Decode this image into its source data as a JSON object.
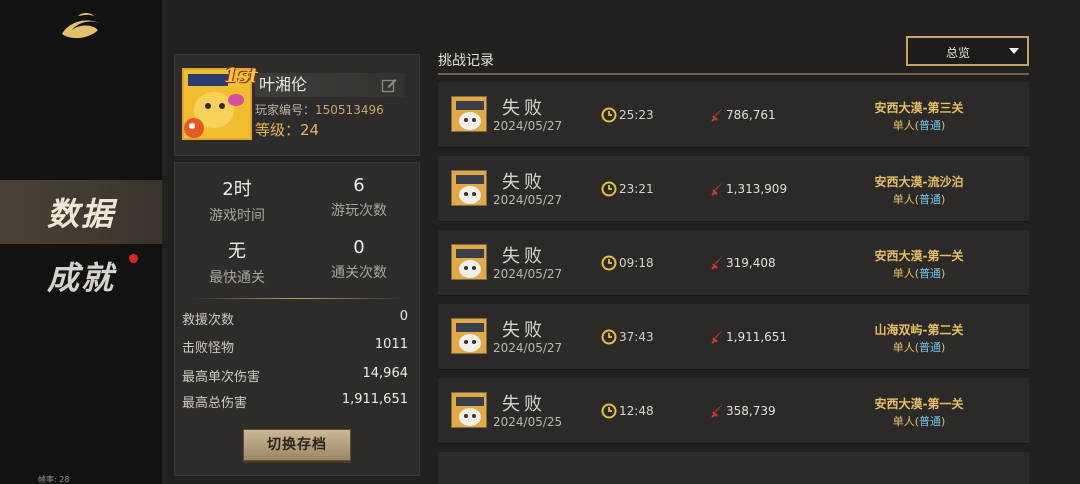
{
  "nav": {
    "items": [
      {
        "label": "数据",
        "active": true
      },
      {
        "label": "成就",
        "active": false,
        "has_notification": true
      }
    ],
    "fps_label": "帧率: 28"
  },
  "profile": {
    "rank_badge": "1st",
    "name": "叶湘伦",
    "id_label": "玩家编号：",
    "id_value": "150513496",
    "level_label": "等级：",
    "level_value": "24"
  },
  "stats": {
    "play_time_value": "2时",
    "play_time_label": "游戏时间",
    "play_count_value": "6",
    "play_count_label": "游玩次数",
    "fastest_clear_value": "无",
    "fastest_clear_label": "最快通关",
    "clear_count_value": "0",
    "clear_count_label": "通关次数",
    "rows": [
      {
        "label": "救援次数",
        "value": "0"
      },
      {
        "label": "击败怪物",
        "value": "1011"
      },
      {
        "label": "最高单次伤害",
        "value": "14,964"
      },
      {
        "label": "最高总伤害",
        "value": "1,911,651"
      }
    ],
    "switch_save_label": "切换存档"
  },
  "records": {
    "title": "挑战记录",
    "filter_selected": "总览",
    "items": [
      {
        "result": "失败",
        "date": "2024/05/27",
        "time": "25:23",
        "damage": "786,761",
        "stage": "安西大漠-第三关",
        "mode": "单人",
        "difficulty": "普通"
      },
      {
        "result": "失败",
        "date": "2024/05/27",
        "time": "23:21",
        "damage": "1,313,909",
        "stage": "安西大漠-流沙泊",
        "mode": "单人",
        "difficulty": "普通"
      },
      {
        "result": "失败",
        "date": "2024/05/27",
        "time": "09:18",
        "damage": "319,408",
        "stage": "安西大漠-第一关",
        "mode": "单人",
        "difficulty": "普通"
      },
      {
        "result": "失败",
        "date": "2024/05/27",
        "time": "37:43",
        "damage": "1,911,651",
        "stage": "山海双屿-第二关",
        "mode": "单人",
        "difficulty": "普通"
      },
      {
        "result": "失败",
        "date": "2024/05/25",
        "time": "12:48",
        "damage": "358,739",
        "stage": "安西大漠-第一关",
        "mode": "单人",
        "difficulty": "普通"
      }
    ]
  },
  "icons": {
    "logo": "swirl-logo-icon",
    "edit": "edit-icon",
    "clock": "clock-icon",
    "sword": "sword-icon",
    "dropdown": "chevron-down-icon"
  },
  "colors": {
    "gold_accent": "#c4a463",
    "stage_text": "#e7bf64",
    "difficulty_text": "#6cc6e8",
    "notification_dot": "#e02424"
  }
}
